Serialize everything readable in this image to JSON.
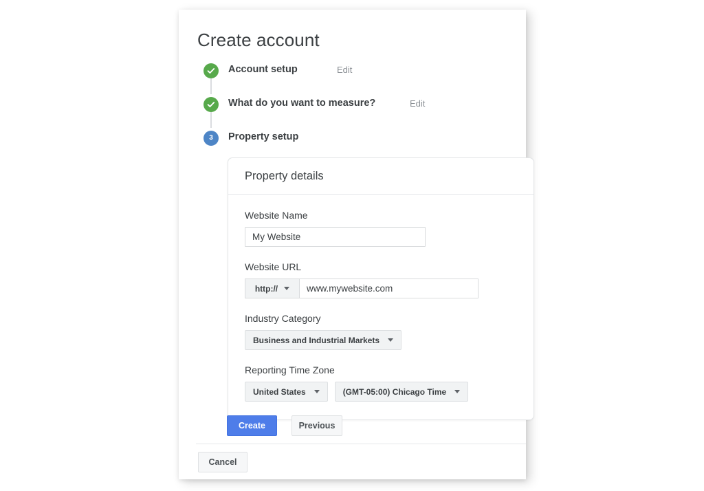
{
  "page": {
    "title": "Create account"
  },
  "stepper": {
    "steps": [
      {
        "label": "Account setup",
        "state": "done",
        "marker": "check-icon",
        "edit_label": "Edit",
        "has_edit": true
      },
      {
        "label": "What do you want to measure?",
        "state": "done",
        "marker": "check-icon",
        "edit_label": "Edit",
        "has_edit": true
      },
      {
        "label": "Property setup",
        "state": "current",
        "marker": "3",
        "edit_label": "",
        "has_edit": false
      }
    ]
  },
  "card": {
    "header_title": "Property details",
    "fields": {
      "website_name": {
        "label": "Website Name",
        "value": "My Website",
        "placeholder": ""
      },
      "website_url": {
        "label": "Website URL",
        "protocol_value": "http://",
        "value": "www.mywebsite.com",
        "placeholder": ""
      },
      "industry_category": {
        "label": "Industry Category",
        "value": "Business and Industrial Markets"
      },
      "reporting_time_zone": {
        "label": "Reporting Time Zone",
        "country_value": "United States",
        "zone_value": "(GMT-05:00) Chicago Time"
      }
    }
  },
  "actions": {
    "create_label": "Create",
    "previous_label": "Previous",
    "cancel_label": "Cancel"
  },
  "colors": {
    "step_done": "#57a94b",
    "step_current": "#4d85c6",
    "primary_button": "#4e7de9",
    "text": "#3c4043",
    "muted_text": "#8a8f94",
    "chip_bg": "#f1f3f4"
  }
}
